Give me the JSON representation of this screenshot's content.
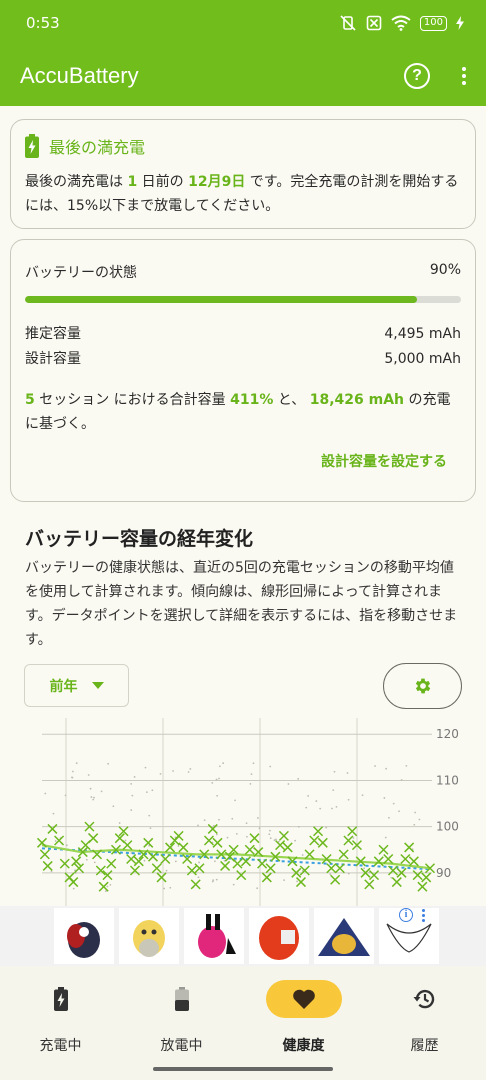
{
  "status_bar": {
    "time": "0:53",
    "battery": "100"
  },
  "app_bar": {
    "title": "AccuBattery",
    "help_label": "?"
  },
  "last_charge_card": {
    "title": "最後の満充電",
    "text_pre": "最後の満充電は ",
    "days": "1",
    "text_mid": " 日前の ",
    "date": "12月9日",
    "text_post": " です。完全充電の計測を開始するには、15%以下まで放電してください。"
  },
  "health_card": {
    "label": "バッテリーの状態",
    "percent_text": "90%",
    "health_fraction": 0.9,
    "estimated_label": "推定容量",
    "estimated_value": "4,495 mAh",
    "design_label": "設計容量",
    "design_value": "5,000 mAh",
    "sessions": "5",
    "text_a": " セッション における合計容量 ",
    "total_pct": "411%",
    "text_b": " と、 ",
    "total_mah": "18,426 mAh",
    "text_c": " の充電に基づく。",
    "set_design_capacity": "設計容量を設定する"
  },
  "capacity_section": {
    "title": "バッテリー容量の経年変化",
    "description": "バッテリーの健康状態は、直近の5回の充電セッションの移動平均値を使用して計算されます。傾向線は、線形回帰によって計算されます。データポイントを選択して詳細を表示するには、指を移動させます。",
    "period": "前年"
  },
  "chart_data": {
    "type": "scatter",
    "y_ticks": [
      "120",
      "110",
      "100",
      "90"
    ],
    "ylim": [
      86,
      122
    ],
    "colors": {
      "points": "#6cb81e",
      "moving_average": "#9ad651",
      "trend": "#3a9fe0",
      "dots": "#bdbdb4"
    },
    "session_points": [
      [
        0.0,
        96.5
      ],
      [
        0.3,
        94
      ],
      [
        0.6,
        91.5
      ],
      [
        1.1,
        99.5
      ],
      [
        1.8,
        97
      ],
      [
        2.4,
        92
      ],
      [
        2.9,
        89
      ],
      [
        3.3,
        88
      ],
      [
        3.6,
        92.5
      ],
      [
        3.9,
        91
      ],
      [
        4.3,
        94.5
      ],
      [
        4.6,
        96
      ],
      [
        5.0,
        100
      ],
      [
        5.4,
        97.5
      ],
      [
        5.8,
        94
      ],
      [
        6.2,
        90.5
      ],
      [
        6.5,
        87
      ],
      [
        6.9,
        89.5
      ],
      [
        7.3,
        92
      ],
      [
        7.8,
        95
      ],
      [
        8.2,
        97.5
      ],
      [
        8.6,
        99
      ],
      [
        9.0,
        96
      ],
      [
        9.4,
        93
      ],
      [
        9.8,
        90.5
      ],
      [
        10.2,
        92.5
      ],
      [
        10.7,
        94
      ],
      [
        11.2,
        96.5
      ],
      [
        11.7,
        93.5
      ],
      [
        12.1,
        91
      ],
      [
        12.6,
        89
      ],
      [
        13.0,
        93
      ],
      [
        13.5,
        95.5
      ],
      [
        14.0,
        97
      ],
      [
        14.4,
        98
      ],
      [
        14.9,
        95.5
      ],
      [
        15.3,
        93
      ],
      [
        15.8,
        90.5
      ],
      [
        16.2,
        87.5
      ],
      [
        16.6,
        91
      ],
      [
        17.1,
        94
      ],
      [
        17.6,
        97
      ],
      [
        18.0,
        99.5
      ],
      [
        18.5,
        96.5
      ],
      [
        18.9,
        94
      ],
      [
        19.3,
        91.5
      ],
      [
        19.8,
        93.5
      ],
      [
        20.2,
        95
      ],
      [
        20.6,
        92
      ],
      [
        21.0,
        89.5
      ],
      [
        21.5,
        92.5
      ],
      [
        21.9,
        95
      ],
      [
        22.4,
        97.5
      ],
      [
        22.8,
        94.5
      ],
      [
        23.2,
        92
      ],
      [
        23.7,
        89
      ],
      [
        24.1,
        91
      ],
      [
        24.6,
        93.5
      ],
      [
        25.1,
        96
      ],
      [
        25.5,
        98
      ],
      [
        25.9,
        95.5
      ],
      [
        26.4,
        92.5
      ],
      [
        26.8,
        90
      ],
      [
        27.3,
        88
      ],
      [
        27.7,
        90.5
      ],
      [
        28.2,
        94
      ],
      [
        28.7,
        97
      ],
      [
        29.1,
        99
      ],
      [
        29.6,
        96.5
      ],
      [
        30.0,
        93
      ],
      [
        30.5,
        91
      ],
      [
        30.9,
        88.5
      ],
      [
        31.4,
        91
      ],
      [
        31.8,
        94
      ],
      [
        32.3,
        97
      ],
      [
        32.7,
        99
      ],
      [
        33.2,
        96
      ],
      [
        33.6,
        92.5
      ],
      [
        34.1,
        90
      ],
      [
        34.5,
        87.5
      ],
      [
        35.0,
        89.5
      ],
      [
        35.5,
        92.5
      ],
      [
        36.0,
        95
      ],
      [
        36.5,
        93
      ],
      [
        37.0,
        90.5
      ],
      [
        37.4,
        88
      ],
      [
        37.9,
        90
      ],
      [
        38.3,
        93
      ],
      [
        38.7,
        95.5
      ],
      [
        39.2,
        92.5
      ],
      [
        39.6,
        89.5
      ],
      [
        40.1,
        87
      ],
      [
        40.5,
        89
      ],
      [
        40.9,
        91
      ]
    ],
    "moving_average": [
      [
        0,
        96
      ],
      [
        4,
        94.5
      ],
      [
        8,
        95
      ],
      [
        12,
        94.5
      ],
      [
        16,
        94
      ],
      [
        20,
        94
      ],
      [
        24,
        93.5
      ],
      [
        28,
        93
      ],
      [
        32,
        92.5
      ],
      [
        36,
        92
      ],
      [
        40,
        91
      ]
    ],
    "trend_line": [
      [
        0,
        95.3
      ],
      [
        40,
        90.8
      ]
    ]
  },
  "ad": {
    "info_label": "i"
  },
  "bottom_nav": {
    "items": [
      {
        "label": "充電中",
        "icon": "battery-charging-icon"
      },
      {
        "label": "放電中",
        "icon": "battery-discharging-icon"
      },
      {
        "label": "健康度",
        "icon": "heart-icon"
      },
      {
        "label": "履歴",
        "icon": "history-icon"
      }
    ]
  }
}
